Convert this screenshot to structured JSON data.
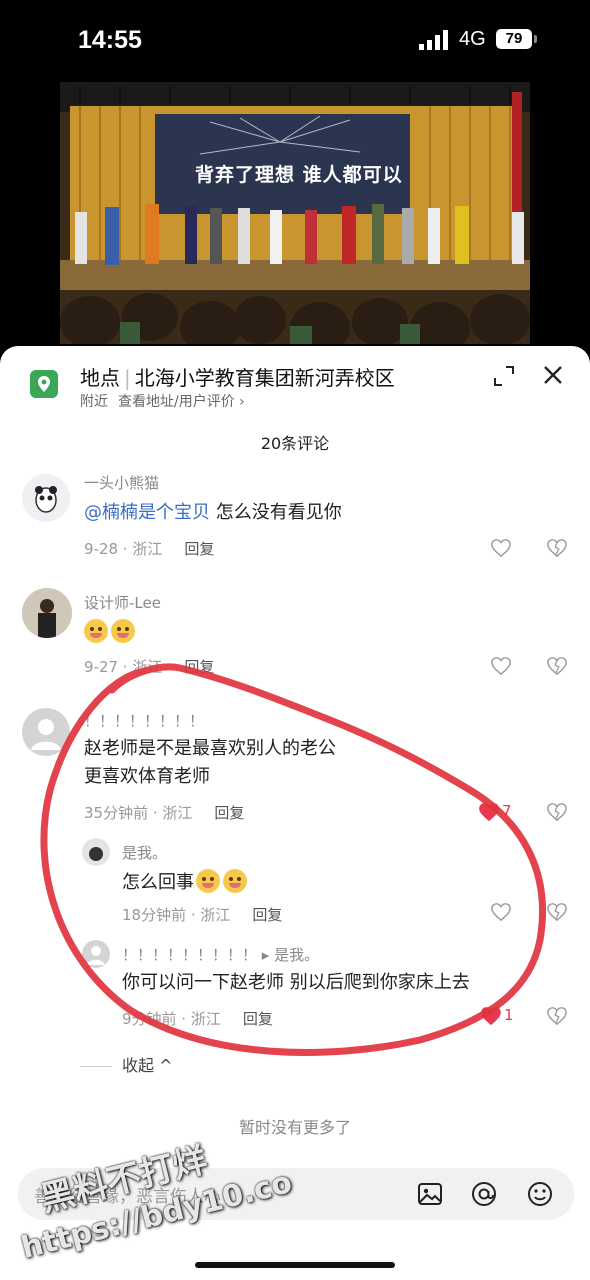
{
  "status": {
    "time": "14:55",
    "network": "4G",
    "battery": "79"
  },
  "video": {
    "banner_text": "背弃了理想  谁人都可以"
  },
  "location": {
    "label": "地点",
    "name": "北海小学教育集团新河弄校区",
    "sub_near": "附近",
    "sub_link": "查看地址/用户评价 ›"
  },
  "comment_count": "20条评论",
  "comments": [
    {
      "name": "一头小熊猫",
      "mention": "@楠楠是个宝贝",
      "text": " 怎么没有看见你",
      "meta": "9-28 · 浙江",
      "reply": "回复"
    },
    {
      "name": "设计师-Lee",
      "meta": "9-27 · 浙江",
      "reply": "回复"
    },
    {
      "name": "！！！！！！！！",
      "text_line1": "赵老师是不是最喜欢别人的老公",
      "text_line2": "更喜欢体育老师",
      "meta": "35分钟前 · 浙江",
      "reply": "回复",
      "likes": "7"
    }
  ],
  "replies": [
    {
      "name": "是我。",
      "text": "怎么回事",
      "meta": "18分钟前 · 浙江",
      "reply": "回复"
    },
    {
      "name": "！！！！！！！！！ ▸ 是我。",
      "text": "你可以问一下赵老师   别以后爬到你家床上去",
      "meta": "9分钟前 · 浙江",
      "reply": "回复",
      "likes": "1"
    }
  ],
  "collapse_label": "收起 ^",
  "no_more": "暂时没有更多了",
  "input": {
    "placeholder": "善语结善缘，恶言伤人心"
  },
  "watermark": {
    "line1": "黑料不打烊",
    "line2": "https://bdy10.co"
  },
  "icons": [
    "location-icon",
    "expand-icon",
    "close-icon",
    "heart-icon",
    "dislike-icon",
    "image-icon",
    "at-icon",
    "emoji-icon"
  ],
  "colors": {
    "accent_red": "#e8384f",
    "link_blue": "#3b6cc4",
    "location_green": "#3aa757"
  }
}
